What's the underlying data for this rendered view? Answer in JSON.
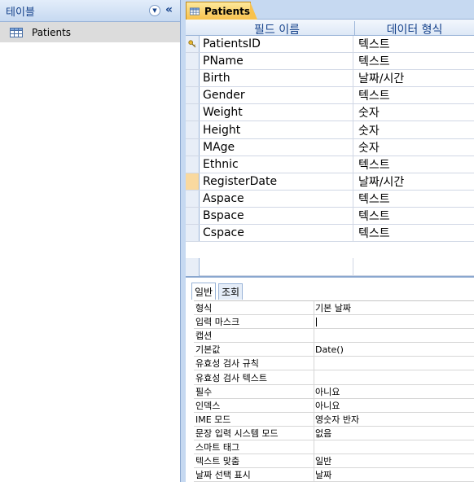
{
  "nav": {
    "title": "테이블",
    "item_label": "Patients"
  },
  "document": {
    "tab_label": "Patients"
  },
  "grid": {
    "headers": {
      "field_name": "필드 이름",
      "data_type": "데이터 형식"
    },
    "rows": [
      {
        "name": "PatientsID",
        "type": "텍스트",
        "primary_key": true
      },
      {
        "name": "PName",
        "type": "텍스트"
      },
      {
        "name": "Birth",
        "type": "날짜/시간"
      },
      {
        "name": "Gender",
        "type": "텍스트"
      },
      {
        "name": "Weight",
        "type": "숫자"
      },
      {
        "name": "Height",
        "type": "숫자"
      },
      {
        "name": "MAge",
        "type": "숫자"
      },
      {
        "name": "Ethnic",
        "type": "텍스트"
      },
      {
        "name": "RegisterDate",
        "type": "날짜/시간",
        "current": true
      },
      {
        "name": "Aspace",
        "type": "텍스트"
      },
      {
        "name": "Bspace",
        "type": "텍스트"
      },
      {
        "name": "Cspace",
        "type": "텍스트"
      }
    ]
  },
  "properties": {
    "tabs": {
      "general": "일반",
      "lookup": "조회"
    },
    "rows": [
      {
        "label": "형식",
        "value": "기본 날짜"
      },
      {
        "label": "입력 마스크",
        "value": ""
      },
      {
        "label": "캡션",
        "value": ""
      },
      {
        "label": "기본값",
        "value": "Date()"
      },
      {
        "label": "유효성 검사 규칙",
        "value": ""
      },
      {
        "label": "유효성 검사 텍스트",
        "value": ""
      },
      {
        "label": "필수",
        "value": "아니요"
      },
      {
        "label": "인덱스",
        "value": "아니요"
      },
      {
        "label": "IME 모드",
        "value": "영숫자 반자"
      },
      {
        "label": "문장 입력 시스템 모드",
        "value": "없음"
      },
      {
        "label": "스마트 태그",
        "value": ""
      },
      {
        "label": "텍스트 맞춤",
        "value": "일반"
      },
      {
        "label": "날짜 선택 표시",
        "value": "날짜"
      }
    ]
  },
  "colors": {
    "accent": "#15428b",
    "tab_active": "#f8c24d",
    "row_current_selector": "#f9d99f"
  }
}
